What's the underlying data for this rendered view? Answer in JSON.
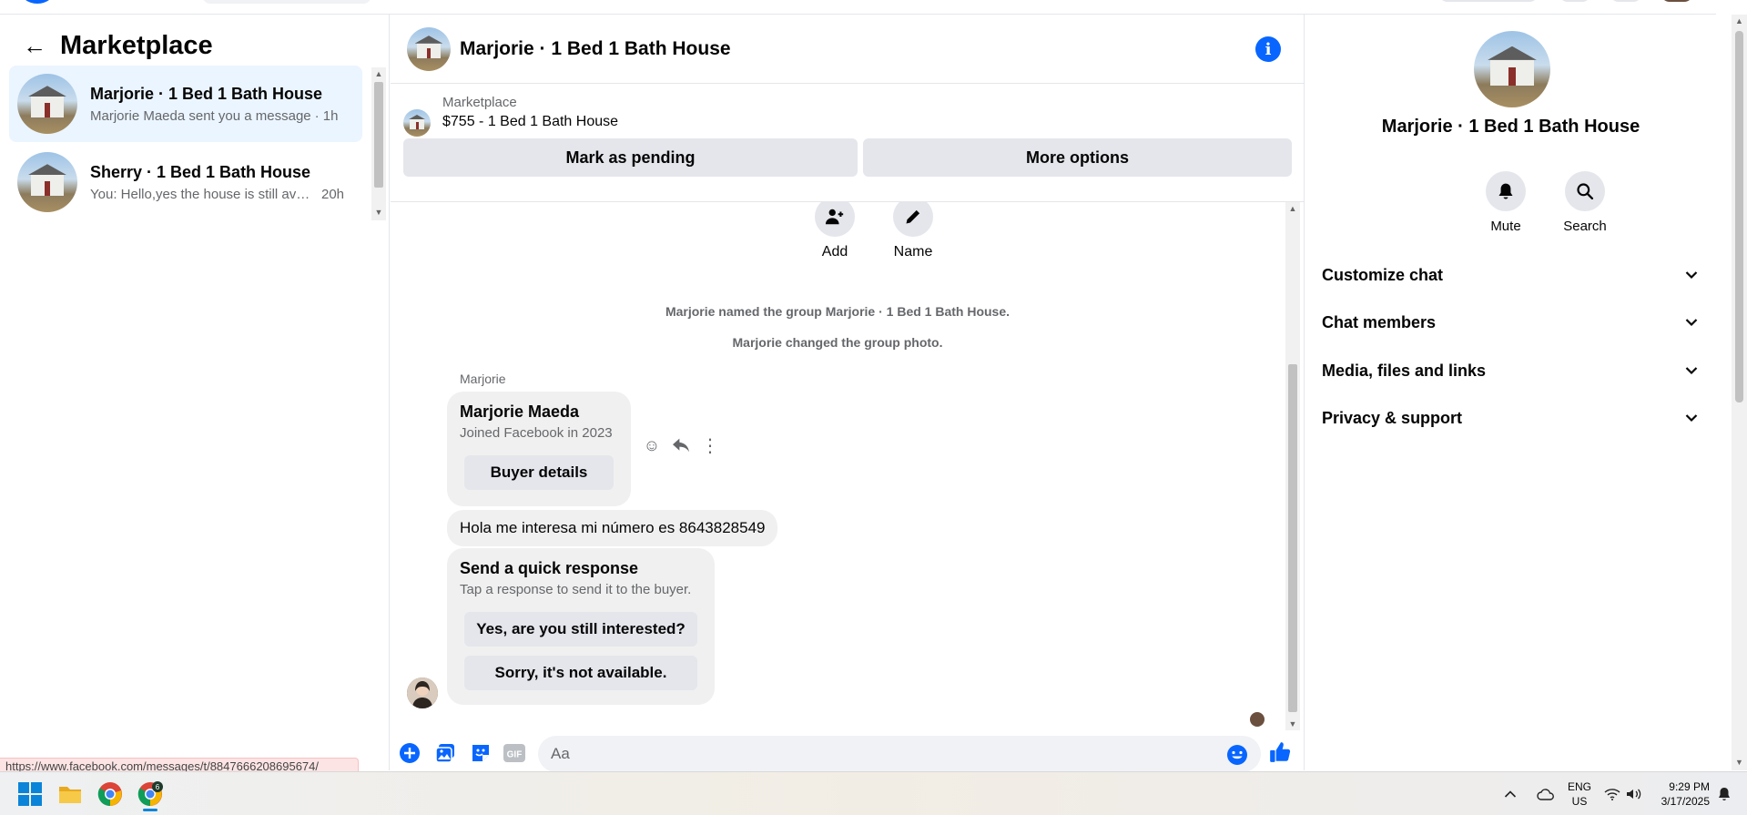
{
  "left": {
    "title": "Marketplace",
    "conversations": [
      {
        "name": "Marjorie · 1 Bed 1 Bath House",
        "snippet": "Marjorie Maeda sent you a message",
        "time": "· 1h"
      },
      {
        "name": "Sherry · 1 Bed 1 Bath House",
        "snippet": "You: Hello,yes the house is still available",
        "time": "20h"
      }
    ]
  },
  "status_url": "https://www.facebook.com/messages/t/8847666208695674/",
  "chat": {
    "title": "Marjorie · 1 Bed 1 Bath House",
    "listing": {
      "source": "Marketplace",
      "price_title": "$755 - 1 Bed 1 Bath House",
      "mark_pending": "Mark as pending",
      "more_options": "More options"
    },
    "actions": {
      "add": "Add",
      "name": "Name"
    },
    "system_messages": [
      "Marjorie named the group Marjorie · 1 Bed 1 Bath House.",
      "Marjorie changed the group photo."
    ],
    "sender": "Marjorie",
    "profile_card": {
      "name": "Marjorie Maeda",
      "subtitle": "Joined Facebook in 2023",
      "button": "Buyer details"
    },
    "message_text": "Hola me interesa mi número es 8643828549",
    "quick_response": {
      "title": "Send a quick response",
      "subtitle": "Tap a response to send it to the buyer.",
      "option1": "Yes, are you still interested?",
      "option2": "Sorry, it's not available."
    },
    "composer": {
      "placeholder": "Aa"
    }
  },
  "right": {
    "name": "Marjorie · 1 Bed 1 Bath House",
    "mute": "Mute",
    "search": "Search",
    "sections": [
      "Customize chat",
      "Chat members",
      "Media, files and links",
      "Privacy & support"
    ]
  },
  "taskbar": {
    "lang_top": "ENG",
    "lang_bottom": "US",
    "time": "9:29 PM",
    "date": "3/17/2025",
    "chrome_badge": "6"
  },
  "colors": {
    "brand": "#0866ff",
    "active_conv": "#ebf5ff",
    "bubble": "#f0f0f0"
  }
}
